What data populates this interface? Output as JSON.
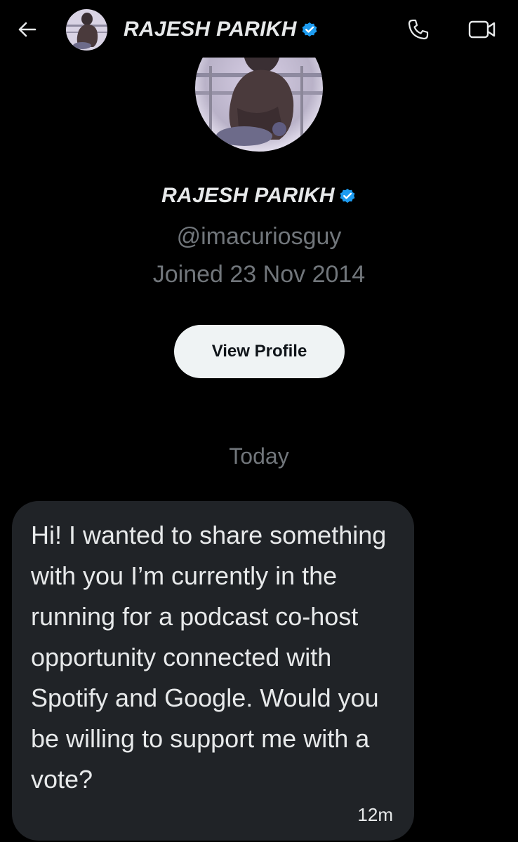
{
  "header": {
    "back_icon": "arrow-left-icon",
    "name": "RAJESH PARIKH",
    "verified_icon": "verified-badge-icon",
    "call_icon": "phone-icon",
    "video_icon": "video-camera-icon"
  },
  "profile": {
    "name": "RAJESH PARIKH",
    "handle": "@imacuriosguy",
    "joined": "Joined 23 Nov 2014",
    "view_profile_label": "View Profile"
  },
  "conversation": {
    "day_separator": "Today",
    "messages": [
      {
        "text": "Hi! I wanted to share something with you I’m currently in the running for a podcast co-host opportunity connected with Spotify and Google. Would you be willing to support me with a vote?",
        "time": "12m"
      }
    ]
  },
  "colors": {
    "background": "#000000",
    "text_primary": "#e7e9ea",
    "text_secondary": "#71767b",
    "bubble": "#202327",
    "button_bg": "#eff3f4",
    "button_text": "#0f1419",
    "verified": "#1d9bf0"
  }
}
